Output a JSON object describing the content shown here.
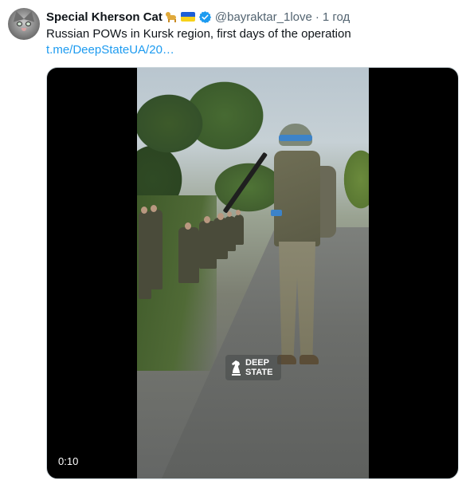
{
  "tweet": {
    "display_name": "Special Kherson Cat",
    "emojis": [
      "dog-icon",
      "ukraine-flag-icon"
    ],
    "verified": true,
    "handle": "@bayraktar_1love",
    "separator": "·",
    "time": "1 год",
    "text": "Russian POWs in Kursk region, first days of the operation",
    "link": "t.me/DeepStateUA/20…"
  },
  "media": {
    "watermark_line1": "DEEP",
    "watermark_line2": "STATE",
    "duration": "0:10"
  },
  "colors": {
    "link": "#1d9bf0",
    "verified": "#1d9bf0",
    "helmet_band": "#3c83c9",
    "secondary_text": "#536471"
  }
}
